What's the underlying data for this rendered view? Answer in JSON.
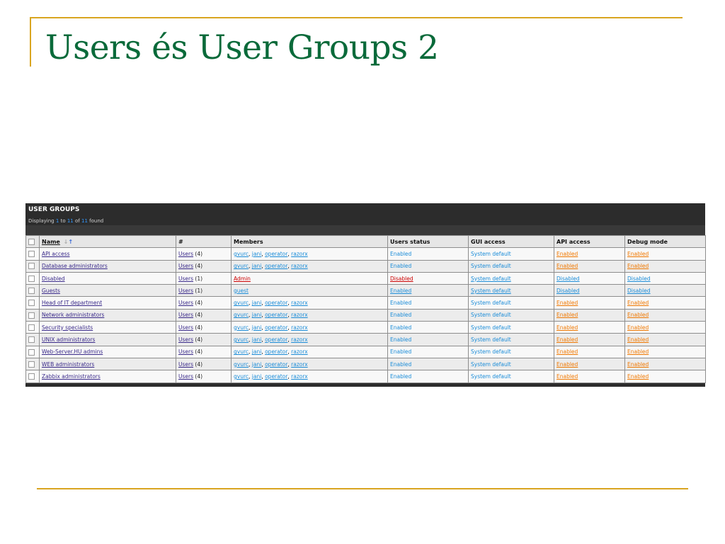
{
  "slide": {
    "title": "Users és User Groups 2"
  },
  "panel": {
    "title": "USER GROUPS",
    "info": {
      "prefix": "Displaying",
      "from": "1",
      "to_word": "to",
      "to": "11",
      "of_word": "of",
      "total": "11",
      "suffix": "found"
    }
  },
  "table": {
    "headers": {
      "name": "Name",
      "count": "#",
      "members": "Members",
      "users_status": "Users status",
      "gui_access": "GUI access",
      "api_access": "API access",
      "debug_mode": "Debug mode"
    },
    "rows": [
      {
        "name": "API access",
        "users_link": "Users",
        "users_count": "(4)",
        "members": [
          "gvurc",
          "jani",
          "operator",
          "razorx"
        ],
        "users_status": "Enabled",
        "gui_access": "System default",
        "api_access": "Enabled",
        "debug_mode": "Enabled"
      },
      {
        "name": "Database administrators",
        "users_link": "Users",
        "users_count": "(4)",
        "members": [
          "gvurc",
          "jani",
          "operator",
          "razorx"
        ],
        "users_status": "Enabled",
        "gui_access": "System default",
        "api_access": "Enabled",
        "debug_mode": "Enabled"
      },
      {
        "name": "Disabled",
        "users_link": "Users",
        "users_count": "(1)",
        "members": [
          "Admin"
        ],
        "users_status": "Disabled",
        "gui_access": "System default",
        "api_access": "Disabled",
        "debug_mode": "Disabled"
      },
      {
        "name": "Guests",
        "users_link": "Users",
        "users_count": "(1)",
        "members": [
          "guest"
        ],
        "users_status": "Enabled",
        "gui_access": "System default",
        "api_access": "Disabled",
        "debug_mode": "Disabled"
      },
      {
        "name": "Head of IT department",
        "users_link": "Users",
        "users_count": "(4)",
        "members": [
          "gvurc",
          "jani",
          "operator",
          "razorx"
        ],
        "users_status": "Enabled",
        "gui_access": "System default",
        "api_access": "Enabled",
        "debug_mode": "Enabled"
      },
      {
        "name": "Network administrators",
        "users_link": "Users",
        "users_count": "(4)",
        "members": [
          "gvurc",
          "jani",
          "operator",
          "razorx"
        ],
        "users_status": "Enabled",
        "gui_access": "System default",
        "api_access": "Enabled",
        "debug_mode": "Enabled"
      },
      {
        "name": "Security specialists",
        "users_link": "Users",
        "users_count": "(4)",
        "members": [
          "gvurc",
          "jani",
          "operator",
          "razorx"
        ],
        "users_status": "Enabled",
        "gui_access": "System default",
        "api_access": "Enabled",
        "debug_mode": "Enabled"
      },
      {
        "name": "UNIX administrators",
        "users_link": "Users",
        "users_count": "(4)",
        "members": [
          "gvurc",
          "jani",
          "operator",
          "razorx"
        ],
        "users_status": "Enabled",
        "gui_access": "System default",
        "api_access": "Enabled",
        "debug_mode": "Enabled"
      },
      {
        "name": "Web-Server.HU admins",
        "users_link": "Users",
        "users_count": "(4)",
        "members": [
          "gvurc",
          "jani",
          "operator",
          "razorx"
        ],
        "users_status": "Enabled",
        "gui_access": "System default",
        "api_access": "Enabled",
        "debug_mode": "Enabled"
      },
      {
        "name": "WEB administrators",
        "users_link": "Users",
        "users_count": "(4)",
        "members": [
          "gvurc",
          "jani",
          "operator",
          "razorx"
        ],
        "users_status": "Enabled",
        "gui_access": "System default",
        "api_access": "Enabled",
        "debug_mode": "Enabled"
      },
      {
        "name": "Zabbix administrators",
        "users_link": "Users",
        "users_count": "(4)",
        "members": [
          "gvurc",
          "jani",
          "operator",
          "razorx"
        ],
        "users_status": "Enabled",
        "gui_access": "System default",
        "api_access": "Enabled",
        "debug_mode": "Enabled"
      }
    ]
  },
  "colors": {
    "title_green": "#0a6a3a",
    "accent_gold": "#d9a520",
    "panel_dark": "#2c2c2c",
    "link_blue": "#1a8cd8",
    "link_orange": "#f07800",
    "link_red": "#cc0000",
    "link_purple": "#3a2a8a"
  }
}
